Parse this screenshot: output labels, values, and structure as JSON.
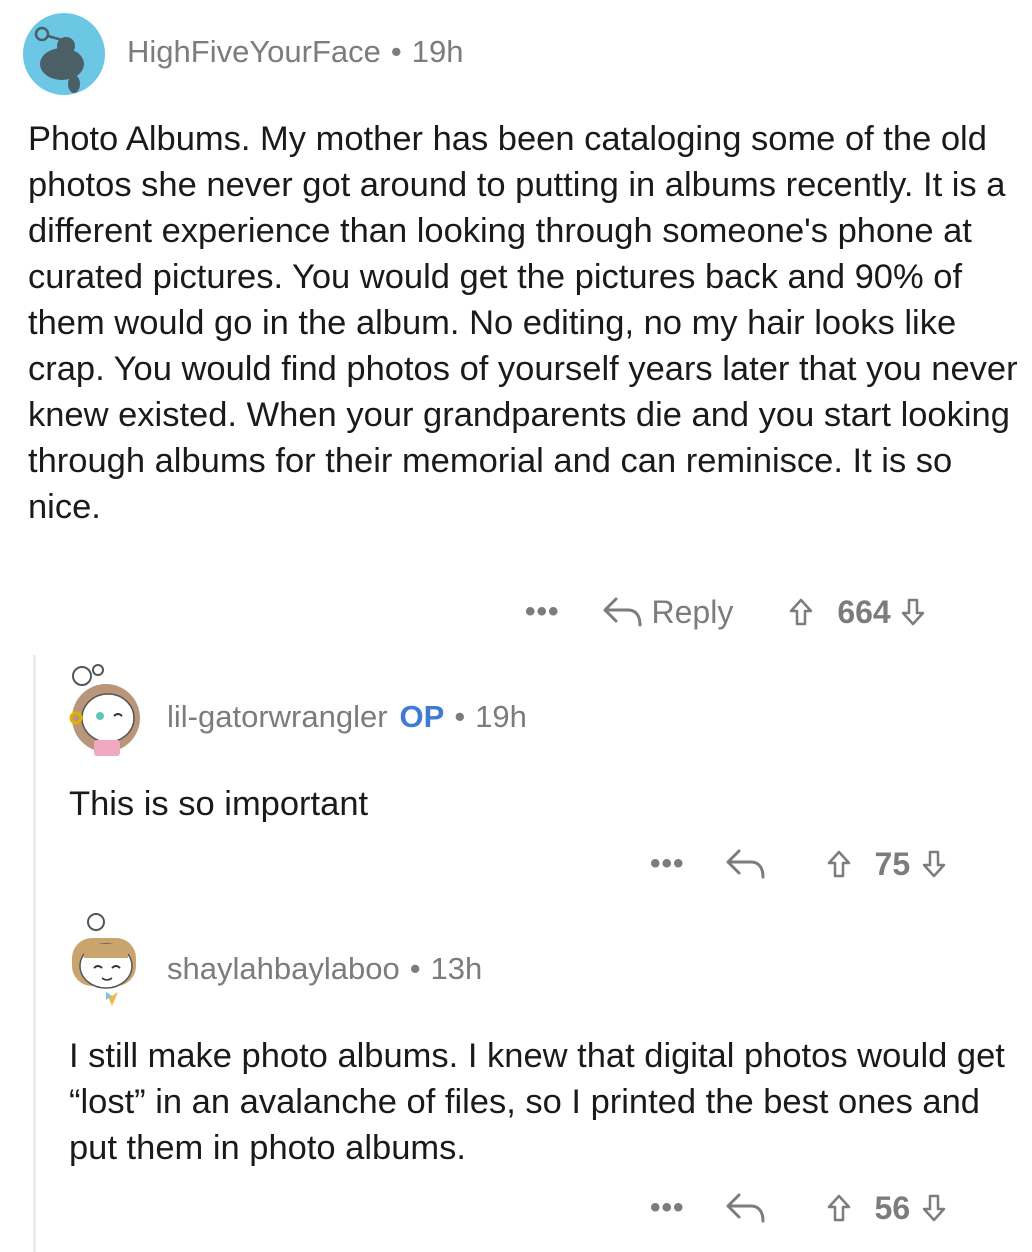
{
  "comments": [
    {
      "username": "HighFiveYourFace",
      "separator": "•",
      "time": "19h",
      "text": "Photo Albums. My mother has been cataloging some of the old photos she never got around to putting in albums recently. It is a different experience than looking through someone's phone at curated pictures. You would get the pictures back and 90% of them would go in the album. No editing, no my hair looks like crap. You would find photos of yourself years later that you never knew existed. When your grandparents die and you start looking through albums for their memorial and can reminisce. It is so nice.",
      "more": "•••",
      "reply_label": "Reply",
      "votes": "664",
      "avatar_color": "#6cc7e4"
    },
    {
      "username": "lil-gatorwrangler",
      "op_badge": "OP",
      "separator": "•",
      "time": "19h",
      "text": "This is so important",
      "more": "•••",
      "votes": "75"
    },
    {
      "username": "shaylahbaylaboo",
      "separator": "•",
      "time": "13h",
      "text": "I still make photo albums. I knew that digital photos would get “lost” in an avalanche of files, so I printed the best ones and put them in photo albums.",
      "more": "•••",
      "votes": "56"
    }
  ],
  "icons": {
    "reply": "reply-arrow-icon",
    "upvote": "upvote-arrow-icon",
    "downvote": "downvote-arrow-icon"
  }
}
